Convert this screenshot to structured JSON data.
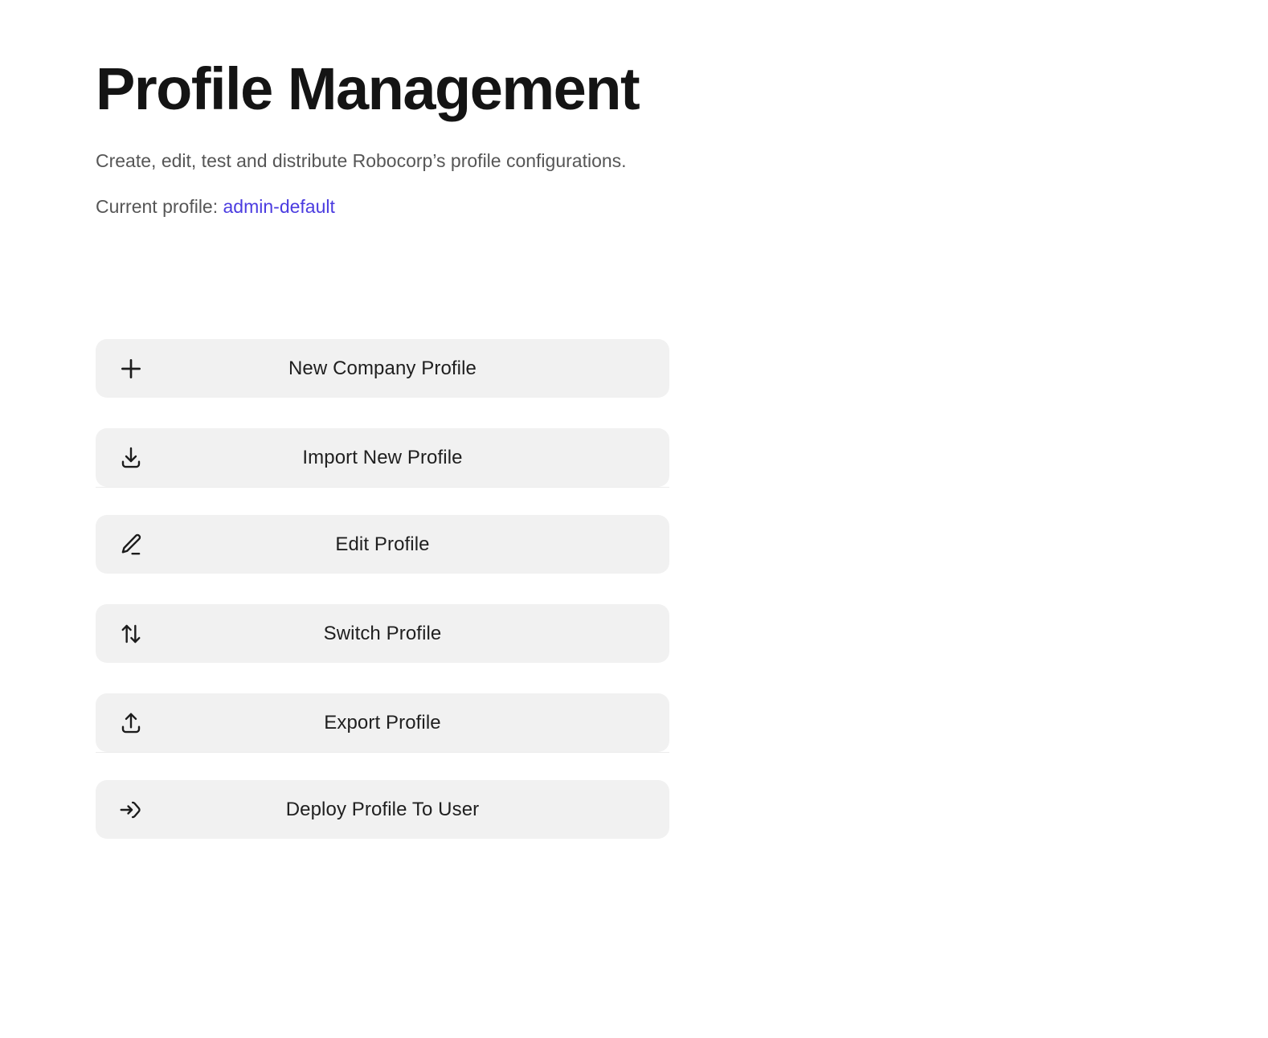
{
  "header": {
    "title": "Profile Management",
    "subtitle": "Create, edit, test and distribute Robocorp’s profile configurations.",
    "current_profile_prefix": "Current profile:",
    "current_profile_value": "admin-default",
    "link_color": "#4b3ce0"
  },
  "actions": {
    "groups": [
      {
        "buttons": [
          {
            "label": "New Company Profile",
            "icon": "plus-icon"
          },
          {
            "label": "Import New Profile",
            "icon": "download-icon"
          }
        ]
      },
      {
        "buttons": [
          {
            "label": "Edit Profile",
            "icon": "pencil-icon"
          },
          {
            "label": "Switch Profile",
            "icon": "arrows-up-down-icon"
          },
          {
            "label": "Export Profile",
            "icon": "upload-icon"
          }
        ]
      },
      {
        "buttons": [
          {
            "label": "Deploy Profile To User",
            "icon": "arrow-right-to-bracket-icon"
          }
        ]
      }
    ]
  },
  "theme": {
    "button_background": "#f1f1f1",
    "divider_color": "#ececec",
    "text_color": "#1f1f1f",
    "muted_text_color": "#565656",
    "page_background": "#ffffff"
  }
}
